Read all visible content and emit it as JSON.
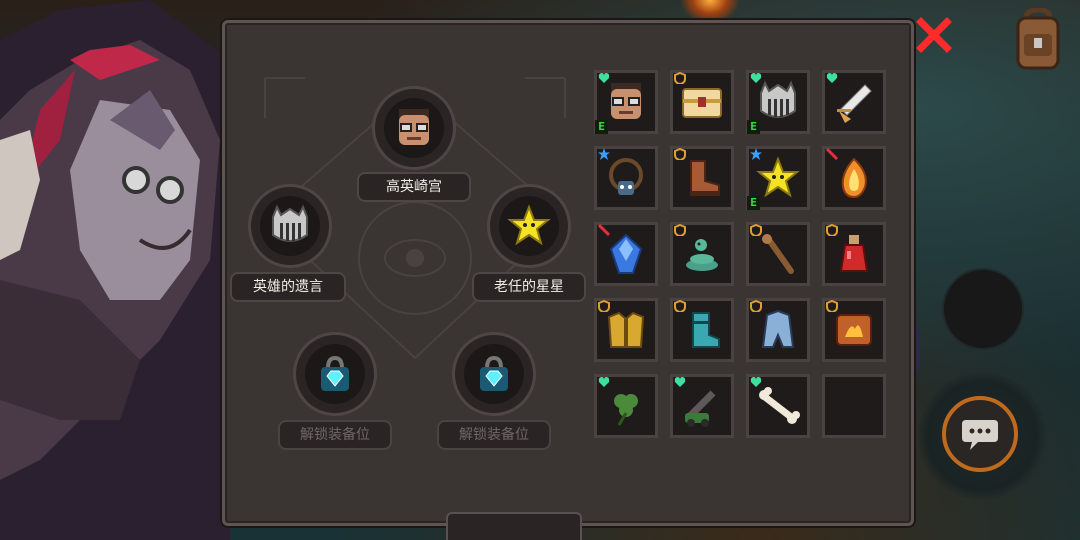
{
  "equipped": {
    "top": {
      "label": "高英崎宫",
      "icon": "bespectacled-head"
    },
    "left": {
      "label": "英雄的遗言",
      "icon": "silver-helmet"
    },
    "right": {
      "label": "老任的星星",
      "icon": "yellow-star"
    },
    "locked_left": {
      "label": "解锁装备位",
      "icon": "diamond-lock"
    },
    "locked_right": {
      "label": "解锁装备位",
      "icon": "diamond-lock"
    }
  },
  "inventory": [
    {
      "icon": "bespectacled-head",
      "tag": "heart",
      "equipped_badge": "E"
    },
    {
      "icon": "treasure-chest",
      "tag": "shield",
      "equipped_badge": ""
    },
    {
      "icon": "silver-helmet",
      "tag": "heart",
      "equipped_badge": "E"
    },
    {
      "icon": "winged-feather",
      "tag": "heart",
      "equipped_badge": ""
    },
    {
      "icon": "fang-necklace",
      "tag": "star",
      "equipped_badge": ""
    },
    {
      "icon": "leather-boot",
      "tag": "shield",
      "equipped_badge": ""
    },
    {
      "icon": "yellow-star",
      "tag": "star",
      "equipped_badge": "E"
    },
    {
      "icon": "flame-crystal",
      "tag": "sword",
      "equipped_badge": ""
    },
    {
      "icon": "blue-gem",
      "tag": "sword",
      "equipped_badge": ""
    },
    {
      "icon": "coiled-snake",
      "tag": "shield",
      "equipped_badge": ""
    },
    {
      "icon": "wooden-staff",
      "tag": "shield",
      "equipped_badge": ""
    },
    {
      "icon": "red-potion",
      "tag": "shield",
      "equipped_badge": ""
    },
    {
      "icon": "golden-armor",
      "tag": "shield",
      "equipped_badge": ""
    },
    {
      "icon": "teal-boot",
      "tag": "shield",
      "equipped_badge": ""
    },
    {
      "icon": "steel-armor",
      "tag": "shield",
      "equipped_badge": ""
    },
    {
      "icon": "fire-scroll",
      "tag": "shield",
      "equipped_badge": ""
    },
    {
      "icon": "clover-leaf",
      "tag": "heart",
      "equipped_badge": ""
    },
    {
      "icon": "green-cannon",
      "tag": "heart",
      "equipped_badge": ""
    },
    {
      "icon": "bone",
      "tag": "heart",
      "equipped_badge": ""
    },
    {
      "icon": "",
      "tag": "",
      "equipped_badge": ""
    }
  ],
  "colors": {
    "heart": "#3fe0a0",
    "shield": "#e0a030",
    "star": "#3aa0ff",
    "sword": "#e03040",
    "close": "#ff2a2a",
    "chat_ring": "#c06a1e"
  },
  "controls": {
    "close_icon": "red-x-icon",
    "bag_icon": "backpack-icon",
    "chat_icon": "chat-bubble-icon"
  }
}
